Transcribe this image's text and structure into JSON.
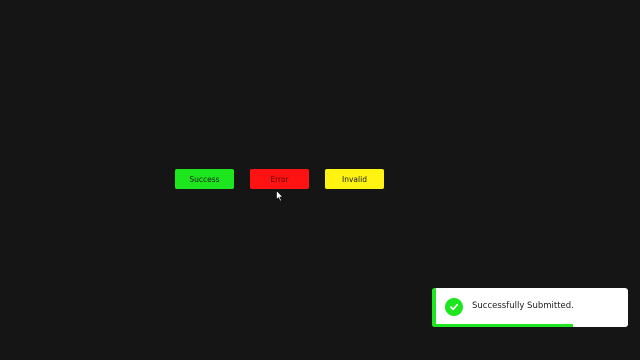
{
  "buttons": {
    "success_label": "Success",
    "error_label": "Error",
    "invalid_label": "Invalid"
  },
  "toast": {
    "message": "Successfully Submitted.",
    "progress": 0.72
  },
  "icons": {
    "toast_icon": "check-circle-icon",
    "cursor": "mouse-pointer-icon"
  },
  "colors": {
    "background": "#151515",
    "success": "#1ee61e",
    "error": "#ff1212",
    "invalid": "#fff312",
    "toast_bg": "#ffffff"
  }
}
